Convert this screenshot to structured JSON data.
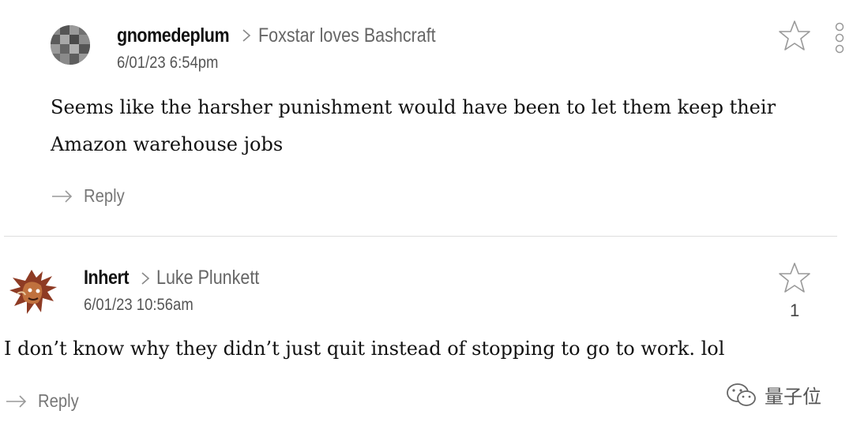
{
  "comments": [
    {
      "username": "gnomedeplum",
      "reply_to": "Foxstar loves Bashcraft",
      "timestamp": "6/01/23 6:54pm",
      "body": "Seems like the harsher punishment would have been to let them keep their Amazon warehouse jobs",
      "reply_label": "Reply",
      "avatar_icon": "pixelated-avatar",
      "star_count": ""
    },
    {
      "username": "Inhert",
      "reply_to": "Luke Plunkett",
      "timestamp": "6/01/23 10:56am",
      "body": "I don’t know why they didn’t just quit instead of stopping to go to work. lol",
      "reply_label": "Reply",
      "avatar_icon": "red-creature-avatar",
      "star_count": "1"
    }
  ],
  "watermark": {
    "text": "量子位",
    "icon": "wechat-icon"
  },
  "colors": {
    "text": "#111111",
    "muted": "#777777",
    "divider": "#dddddd"
  }
}
